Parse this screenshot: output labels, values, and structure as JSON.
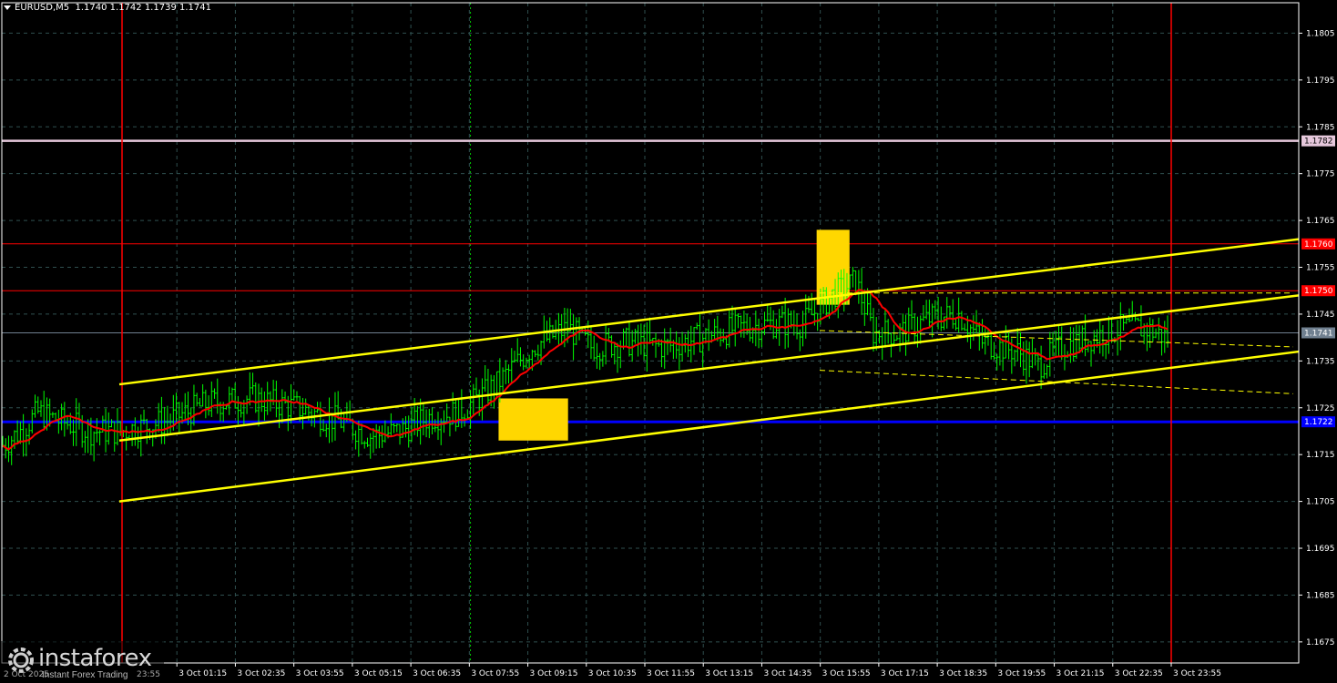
{
  "header": {
    "symbol": "EURUSD,M5",
    "quote": "1.1740 1.1742 1.1739 1.1741"
  },
  "watermark": {
    "brand": "instaforex",
    "tagline": "Instant Forex Trading",
    "date_left": "2 Oct 2025",
    "date_right": "23:55"
  },
  "chart_data": {
    "type": "candlestick",
    "symbol": "EURUSD",
    "timeframe": "M5",
    "y_range": [
      1.16705,
      1.18115
    ],
    "y_ticks": [
      "1.1805",
      "1.1795",
      "1.1785",
      "1.1775",
      "1.1765",
      "1.1755",
      "1.1745",
      "1.1735",
      "1.1725",
      "1.1715",
      "1.1705",
      "1.1695",
      "1.1685",
      "1.1675"
    ],
    "x_tick_labels": [
      "3 Oct 01:15",
      "3 Oct 02:35",
      "3 Oct 03:55",
      "3 Oct 05:15",
      "3 Oct 06:35",
      "3 Oct 07:55",
      "3 Oct 09:15",
      "3 Oct 10:35",
      "3 Oct 11:55",
      "3 Oct 13:15",
      "3 Oct 14:35",
      "3 Oct 15:55",
      "3 Oct 17:15",
      "3 Oct 18:35",
      "3 Oct 19:55",
      "3 Oct 21:15",
      "3 Oct 22:35",
      "3 Oct 23:55"
    ],
    "grid": true,
    "colors": {
      "background": "#000000",
      "candle": "#00ff00",
      "grid": "#2f4f4f",
      "axis_text": "#ffffff",
      "sma": "#ff0000",
      "channel": "#ffff00",
      "support": "#0000ff",
      "resistance": "#ff0000",
      "upper_level": "#e6c8dc",
      "signal_box": "#ffd700",
      "session_line": "#ff0000",
      "current_price": "#708090"
    },
    "horizontal_levels": [
      {
        "price": 1.1782,
        "label": "1.1782",
        "color": "#e6c8dc"
      },
      {
        "price": 1.176,
        "label": "1.1760",
        "color": "#ff0000"
      },
      {
        "price": 1.175,
        "label": "1.1750",
        "color": "#ff0000"
      },
      {
        "price": 1.1741,
        "label": "1.1741",
        "color": "#708090"
      },
      {
        "price": 1.1722,
        "label": "1.1722",
        "color": "#0000ff"
      }
    ],
    "session_lines": [
      "3 Oct 00:00",
      "3 Oct 23:55"
    ],
    "channel": {
      "start": "3 Oct 00:00",
      "end": "3 Oct 23:55",
      "upper": [
        1.173,
        1.1761
      ],
      "middle": [
        1.1718,
        1.1749
      ],
      "lower": [
        1.1705,
        1.1737
      ]
    },
    "signal_boxes": [
      {
        "from": "3 Oct 08:35",
        "to": "3 Oct 10:10",
        "high": 1.1727,
        "low": 1.1718
      },
      {
        "from": "3 Oct 15:50",
        "to": "3 Oct 16:35",
        "high": 1.1763,
        "low": 1.1747
      }
    ],
    "price_path": [
      [
        0,
        1.1717
      ],
      [
        6,
        1.172
      ],
      [
        12,
        1.1724
      ],
      [
        20,
        1.1722
      ],
      [
        30,
        1.172
      ],
      [
        40,
        1.172
      ],
      [
        55,
        1.1722
      ],
      [
        70,
        1.1726
      ],
      [
        85,
        1.1727
      ],
      [
        100,
        1.1725
      ],
      [
        115,
        1.1722
      ],
      [
        125,
        1.1719
      ],
      [
        135,
        1.172
      ],
      [
        145,
        1.1723
      ],
      [
        155,
        1.1724
      ],
      [
        168,
        1.173
      ],
      [
        180,
        1.1738
      ],
      [
        192,
        1.1742
      ],
      [
        200,
        1.1738
      ],
      [
        212,
        1.1739
      ],
      [
        225,
        1.1738
      ],
      [
        238,
        1.174
      ],
      [
        250,
        1.1742
      ],
      [
        262,
        1.1743
      ],
      [
        272,
        1.1743
      ],
      [
        282,
        1.1749
      ],
      [
        290,
        1.1752
      ],
      [
        296,
        1.1741
      ],
      [
        305,
        1.1741
      ],
      [
        315,
        1.1744
      ],
      [
        325,
        1.1745
      ],
      [
        333,
        1.1739
      ],
      [
        345,
        1.1737
      ],
      [
        352,
        1.1734
      ],
      [
        360,
        1.1738
      ],
      [
        370,
        1.174
      ],
      [
        380,
        1.1742
      ],
      [
        388,
        1.1742
      ],
      [
        396,
        1.174
      ]
    ],
    "current_price": 1.1741
  }
}
